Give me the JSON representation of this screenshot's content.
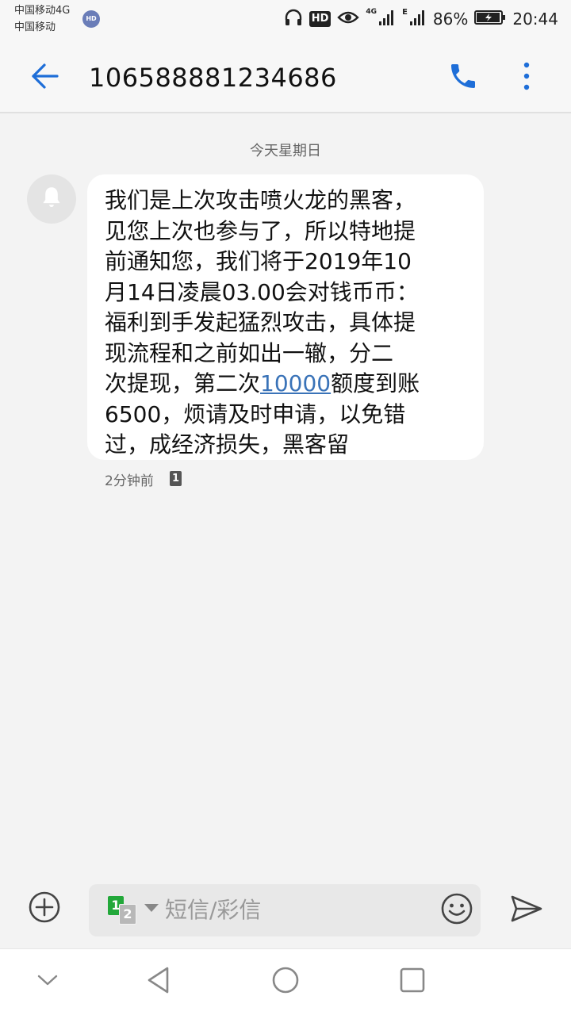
{
  "status_bar": {
    "carrier_line1": "中国移动4G",
    "carrier_line2": "中国移动",
    "hd_badge": "HD",
    "net_label_1": "4G",
    "net_label_2": "E",
    "battery": "86%",
    "time": "20:44",
    "icons": [
      "headphones-icon",
      "hd-icon",
      "eye-icon",
      "signal-icon",
      "signal-icon",
      "battery-icon"
    ]
  },
  "header": {
    "title": "106588881234686",
    "icons": [
      "back-arrow-icon",
      "phone-icon",
      "more-vert-icon"
    ],
    "accent_color": "#1e6ed8"
  },
  "conversation": {
    "date_label": "今天星期日",
    "message": {
      "lines": [
        "我们是上次攻击喷火龙的黑客，",
        "见您上次也参与了，所以特地提",
        "前通知您，我们将于2019年10",
        "月14日凌晨03.00会对钱币币：",
        "福利到手发起猛烈攻击，具体提",
        "现流程和之前如出一辙，分二",
        "6500，烦请及时申请，以免错",
        "过，成经济损失，黑客留"
      ],
      "line7_prefix": "次提现，第二次",
      "line7_link": "10000",
      "line7_suffix": "额度到账",
      "time": "2分钟前",
      "sim": "1"
    }
  },
  "composer": {
    "sim_primary": "1",
    "sim_secondary": "2",
    "placeholder": "短信/彩信",
    "icons": [
      "add-circle-icon",
      "emoji-icon",
      "send-icon"
    ]
  },
  "nav": {
    "icons": [
      "chevron-down-icon",
      "back-triangle-icon",
      "home-circle-icon",
      "recents-square-icon"
    ]
  }
}
